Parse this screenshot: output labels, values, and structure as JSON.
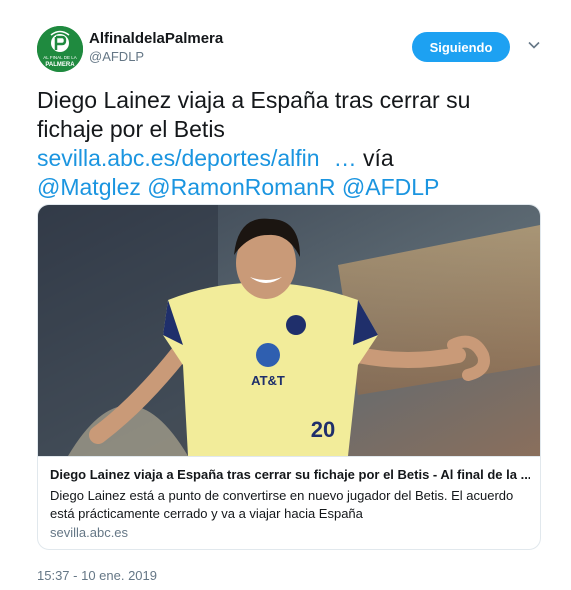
{
  "header": {
    "display_name": "AlfinaldelaPalmera",
    "handle": "@AFDLP",
    "follow_label": "Siguiendo",
    "avatar_text_1": "AL FINAL DE LA",
    "avatar_text_2": "PALMERA"
  },
  "tweet": {
    "line1": "Diego Lainez viaja a España tras cerrar su",
    "line2": "fichaje por el Betis",
    "link": "sevilla.abc.es/deportes/alfin",
    "ellipsis": "…",
    "via": " vía",
    "mentions": [
      "@Matglez",
      "@RamonRomanR",
      "@AFDLP"
    ]
  },
  "card": {
    "title": "Diego Lainez viaja a España tras cerrar su fichaje por el Betis - Al final de la ...",
    "description": "Diego Lainez está a punto de convertirse en nuevo jugador del Betis. El acuerdo está prácticamente cerrado y va a viajar hacia España",
    "domain": "sevilla.abc.es",
    "shirt_text": "AT&T",
    "shirt_number": "20"
  },
  "timestamp": "15:37 - 10 ene. 2019",
  "colors": {
    "accent": "#1da1f2",
    "link": "#1b95e0",
    "muted": "#657786",
    "brand_green": "#1f8a3f"
  }
}
